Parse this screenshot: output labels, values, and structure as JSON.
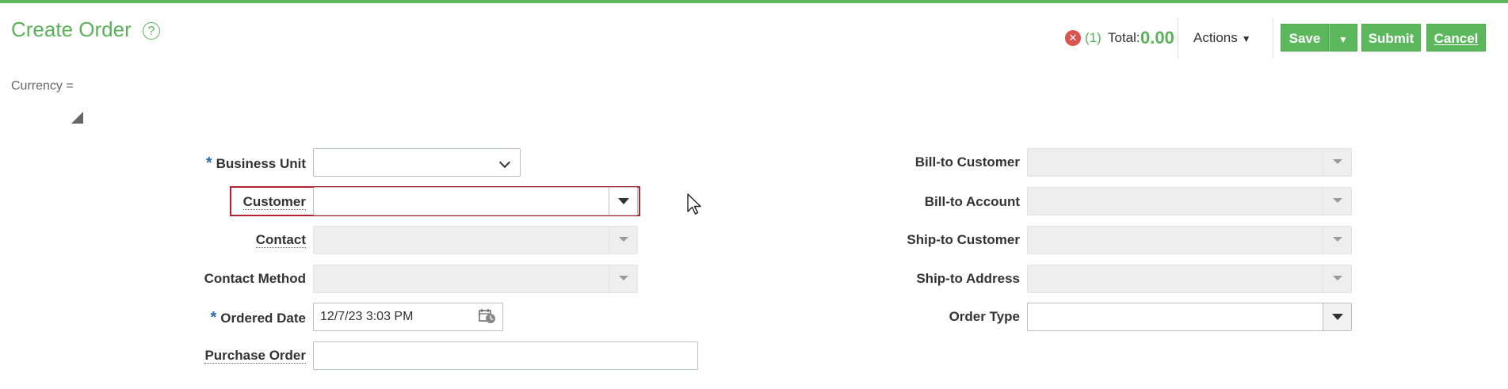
{
  "header": {
    "title": "Create Order",
    "help_icon": "?",
    "error_icon": "✕",
    "error_count": "(1)",
    "total_label": "Total:",
    "total_value": "0.00",
    "actions_label": "Actions",
    "save_label": "Save",
    "submit_label": "Submit",
    "cancel_label": "Cancel"
  },
  "currency_label": "Currency =",
  "form": {
    "business_unit": {
      "label": "Business Unit",
      "required": "*",
      "value": ""
    },
    "customer": {
      "label": "Customer",
      "value": ""
    },
    "contact": {
      "label": "Contact",
      "value": ""
    },
    "contact_method": {
      "label": "Contact Method",
      "value": ""
    },
    "ordered_date": {
      "label": "Ordered Date",
      "required": "*",
      "value": "12/7/23 3:03 PM"
    },
    "purchase_order": {
      "label": "Purchase Order",
      "value": ""
    },
    "bill_to_customer": {
      "label": "Bill-to Customer",
      "value": ""
    },
    "bill_to_account": {
      "label": "Bill-to Account",
      "value": ""
    },
    "ship_to_customer": {
      "label": "Ship-to Customer",
      "value": ""
    },
    "ship_to_address": {
      "label": "Ship-to Address",
      "value": ""
    },
    "order_type": {
      "label": "Order Type",
      "value": ""
    }
  },
  "colors": {
    "brand_green": "#5cb85c",
    "error_red": "#d9534f",
    "highlight_red": "#b1232e",
    "required_blue": "#2d6ca2"
  },
  "icons": {
    "help": "question-circle-icon",
    "error": "error-circle-icon",
    "calendar": "calendar-clock-icon",
    "dropdown": "triangle-down-icon",
    "select": "chevron-down-icon",
    "resize": "corner-resize-icon",
    "pointer": "mouse-cursor-icon"
  }
}
